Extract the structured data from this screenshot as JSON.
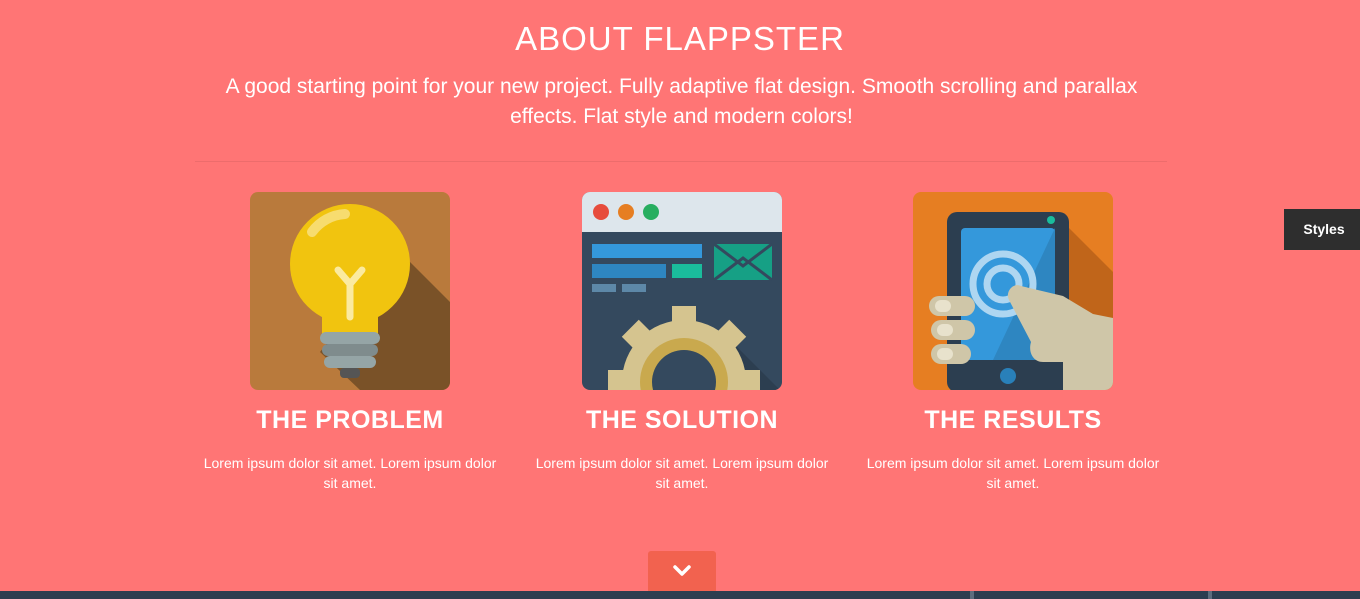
{
  "about": {
    "title": "ABOUT FLAPPSTER",
    "subtitle": "A good starting point for your new project. Fully adaptive flat design. Smooth scrolling and parallax effects. Flat style and modern colors!"
  },
  "features": [
    {
      "icon": "lightbulb-icon",
      "title": "THE PROBLEM",
      "text": "Lorem ipsum dolor sit amet. Lorem ipsum dolor sit amet."
    },
    {
      "icon": "browser-gear-icon",
      "title": "THE SOLUTION",
      "text": "Lorem ipsum dolor sit amet. Lorem ipsum dolor sit amet."
    },
    {
      "icon": "phone-touch-icon",
      "title": "THE RESULTS",
      "text": "Lorem ipsum dolor sit amet. Lorem ipsum dolor sit amet."
    }
  ],
  "styles_tab": {
    "label": "Styles"
  },
  "scroll_down": {
    "icon": "chevron-down-icon"
  },
  "colors": {
    "background": "#ff7575",
    "scroll_button": "#f2624f",
    "styles_tab": "#2e2e2e",
    "bottom_strip": "#2c3e50"
  }
}
